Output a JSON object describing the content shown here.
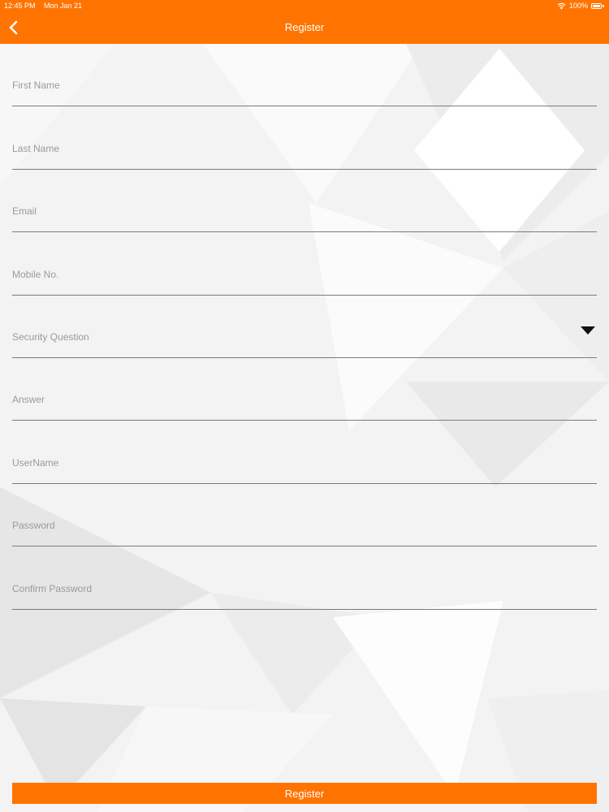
{
  "status_bar": {
    "time": "12:45 PM",
    "date": "Mon Jan 21",
    "battery": "100%"
  },
  "nav": {
    "title": "Register",
    "back_icon": "chevron-left-icon"
  },
  "form": {
    "fields": [
      {
        "label": "First Name"
      },
      {
        "label": "Last Name"
      },
      {
        "label": "Email"
      },
      {
        "label": "Mobile No."
      },
      {
        "label": "Security Question",
        "icon": "caret-down-icon"
      },
      {
        "label": "Answer"
      },
      {
        "label": "UserName"
      },
      {
        "label": "Password"
      },
      {
        "label": "Confirm Password"
      }
    ]
  },
  "register_button": {
    "label": "Register"
  },
  "colors": {
    "accent": "#ff7400",
    "label": "#9a9a9a",
    "underline": "#7a7a7a"
  }
}
